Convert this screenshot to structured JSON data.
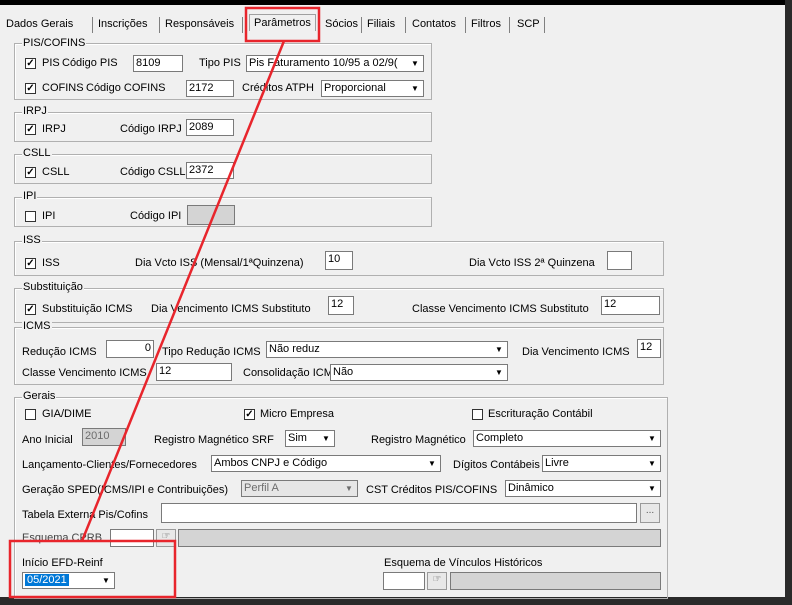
{
  "tabs": [
    {
      "label": "Dados Gerais"
    },
    {
      "label": "Inscrições"
    },
    {
      "label": "Responsáveis"
    },
    {
      "label": "Parâmetros"
    },
    {
      "label": "Sócios"
    },
    {
      "label": "Filiais"
    },
    {
      "label": "Contatos"
    },
    {
      "label": "Filtros"
    },
    {
      "label": "SCP"
    }
  ],
  "pis_cofins": {
    "title": "PIS/COFINS",
    "pis_label": "PIS",
    "pis_code_label": "Código PIS",
    "pis_code": "8109",
    "tipo_pis_label": "Tipo PIS",
    "tipo_pis_value": "Pis Faturamento 10/95 a 02/9(",
    "cofins_label": "COFINS",
    "cofins_code_label": "Código COFINS",
    "cofins_code": "2172",
    "creditos_label": "Créditos ATPH",
    "creditos_value": "Proporcional"
  },
  "irpj": {
    "title": "IRPJ",
    "check_label": "IRPJ",
    "code_label": "Código IRPJ",
    "code": "2089"
  },
  "csll": {
    "title": "CSLL",
    "check_label": "CSLL",
    "code_label": "Código CSLL",
    "code": "2372"
  },
  "ipi": {
    "title": "IPI",
    "check_label": "IPI",
    "code_label": "Código IPI",
    "code": ""
  },
  "iss": {
    "title": "ISS",
    "check_label": "ISS",
    "dia_label": "Dia Vcto ISS (Mensal/1ªQuinzena)",
    "dia_value": "10",
    "dia2_label": "Dia Vcto ISS 2ª Quinzena",
    "dia2_value": ""
  },
  "substituicao": {
    "title": "Substituição",
    "check_label": "Substituição ICMS",
    "dia_label": "Dia Vencimento ICMS Substituto",
    "dia_value": "12",
    "classe_label": "Classe Vencimento ICMS Substituto",
    "classe_value": "12"
  },
  "icms": {
    "title": "ICMS",
    "reducao_label": "Redução ICMS",
    "reducao_value": "0",
    "tipo_label": "Tipo Redução ICMS",
    "tipo_value": "Não reduz",
    "dia_label": "Dia Vencimento ICMS",
    "dia_value": "12",
    "classe_label": "Classe Vencimento ICMS",
    "classe_value": "12",
    "consolidacao_label": "Consolidação ICMS",
    "consolidacao_value": "Não"
  },
  "gerais": {
    "title": "Gerais",
    "gia_label": "GIA/DIME",
    "micro_label": "Micro Empresa",
    "escrituracao_label": "Escrituração Contábil",
    "ano_label": "Ano Inicial",
    "ano_value": "2010",
    "reg_srf_label": "Registro Magnético SRF",
    "reg_srf_value": "Sim",
    "reg_mag_label": "Registro Magnético",
    "reg_mag_value": "Completo",
    "lanc_label": "Lançamento-Clientes/Fornecedores",
    "lanc_value": "Ambos CNPJ e Código",
    "digitos_label": "Dígitos Contábeis",
    "digitos_value": "Livre",
    "sped_label": "Geração SPED(ICMS/IPI e Contribuições)",
    "sped_value": "Perfil A",
    "cst_label": "CST Créditos PIS/COFINS",
    "cst_value": "Dinâmico",
    "tabela_label": "Tabela Externa Pis/Cofins",
    "tabela_btn": "...",
    "esquema_cprb_label": "Esquema CPRB",
    "inicio_label": "Início EFD-Reinf",
    "inicio_value": "05/2021",
    "esquema_vinc_label": "Esquema de Vínculos Históricos"
  },
  "colors": {
    "highlight": "#e8252c",
    "selection": "#0078d7"
  }
}
